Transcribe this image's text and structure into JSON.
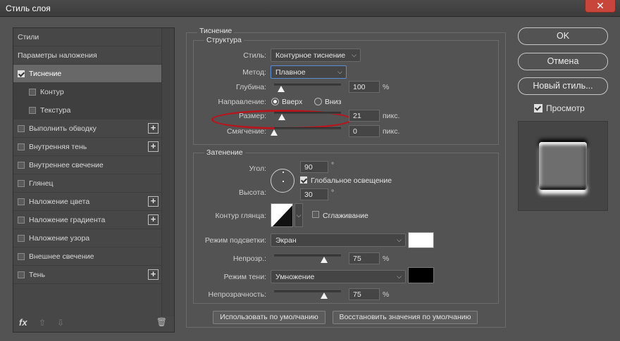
{
  "window": {
    "title": "Стиль слоя",
    "close_icon": "close-icon"
  },
  "left_panel": {
    "items": [
      {
        "label": "Стили",
        "checkbox": false,
        "checked": false,
        "plus": false,
        "selected": false,
        "sub": false
      },
      {
        "label": "Параметры наложения",
        "checkbox": false,
        "checked": false,
        "plus": false,
        "selected": false,
        "sub": false
      },
      {
        "label": "Тиснение",
        "checkbox": true,
        "checked": true,
        "plus": false,
        "selected": true,
        "sub": false
      },
      {
        "label": "Контур",
        "checkbox": true,
        "checked": false,
        "plus": false,
        "selected": false,
        "sub": true
      },
      {
        "label": "Текстура",
        "checkbox": true,
        "checked": false,
        "plus": false,
        "selected": false,
        "sub": true
      },
      {
        "label": "Выполнить обводку",
        "checkbox": true,
        "checked": false,
        "plus": true,
        "selected": false,
        "sub": false
      },
      {
        "label": "Внутренняя тень",
        "checkbox": true,
        "checked": false,
        "plus": true,
        "selected": false,
        "sub": false
      },
      {
        "label": "Внутреннее свечение",
        "checkbox": true,
        "checked": false,
        "plus": false,
        "selected": false,
        "sub": false
      },
      {
        "label": "Глянец",
        "checkbox": true,
        "checked": false,
        "plus": false,
        "selected": false,
        "sub": false
      },
      {
        "label": "Наложение цвета",
        "checkbox": true,
        "checked": false,
        "plus": true,
        "selected": false,
        "sub": false
      },
      {
        "label": "Наложение градиента",
        "checkbox": true,
        "checked": false,
        "plus": true,
        "selected": false,
        "sub": false
      },
      {
        "label": "Наложение узора",
        "checkbox": true,
        "checked": false,
        "plus": false,
        "selected": false,
        "sub": false
      },
      {
        "label": "Внешнее свечение",
        "checkbox": true,
        "checked": false,
        "plus": false,
        "selected": false,
        "sub": false
      },
      {
        "label": "Тень",
        "checkbox": true,
        "checked": false,
        "plus": true,
        "selected": false,
        "sub": false
      }
    ],
    "footer": {
      "fx_label": "fx",
      "move_up_icon": "arrow-up-icon",
      "move_down_icon": "arrow-down-icon",
      "delete_icon": "trash-icon"
    }
  },
  "bevel": {
    "section_title": "Тиснение",
    "structure": {
      "title": "Структура",
      "style_label": "Стиль:",
      "style_value": "Контурное тиснение",
      "technique_label": "Метод:",
      "technique_value": "Плавное",
      "depth_label": "Глубина:",
      "depth_value": "100",
      "depth_unit": "%",
      "direction_label": "Направление:",
      "direction_up": "Вверх",
      "direction_down": "Вниз",
      "direction_selected": "up",
      "size_label": "Размер:",
      "size_value": "21",
      "size_unit": "пикс.",
      "soften_label": "Смягчение:",
      "soften_value": "0",
      "soften_unit": "пикс."
    },
    "shading": {
      "title": "Затенение",
      "angle_label": "Угол:",
      "angle_value": "90",
      "angle_unit": "°",
      "global_light_label": "Глобальное освещение",
      "global_light_checked": true,
      "altitude_label": "Высота:",
      "altitude_value": "30",
      "altitude_unit": "°",
      "gloss_contour_label": "Контур глянца:",
      "anti_aliased_label": "Сглаживание",
      "anti_aliased_checked": false,
      "highlight_mode_label": "Режим подсветки:",
      "highlight_mode_value": "Экран",
      "highlight_color": "#ffffff",
      "highlight_opacity_label": "Непрозр.:",
      "highlight_opacity_value": "75",
      "highlight_opacity_unit": "%",
      "shadow_mode_label": "Режим тени:",
      "shadow_mode_value": "Умножение",
      "shadow_color": "#000000",
      "shadow_opacity_label": "Непрозрачность:",
      "shadow_opacity_value": "75",
      "shadow_opacity_unit": "%"
    },
    "make_default_label": "Использовать по умолчанию",
    "reset_default_label": "Восстановить значения по умолчанию"
  },
  "right_panel": {
    "ok_label": "OK",
    "cancel_label": "Отмена",
    "new_style_label": "Новый стиль...",
    "preview_label": "Просмотр",
    "preview_checked": true
  },
  "sliders": {
    "depth": 0.1,
    "size": 0.12,
    "soften": 0.0,
    "highlight_opacity": 0.75,
    "shadow_opacity": 0.75
  },
  "annotation_color": "#b5171e"
}
